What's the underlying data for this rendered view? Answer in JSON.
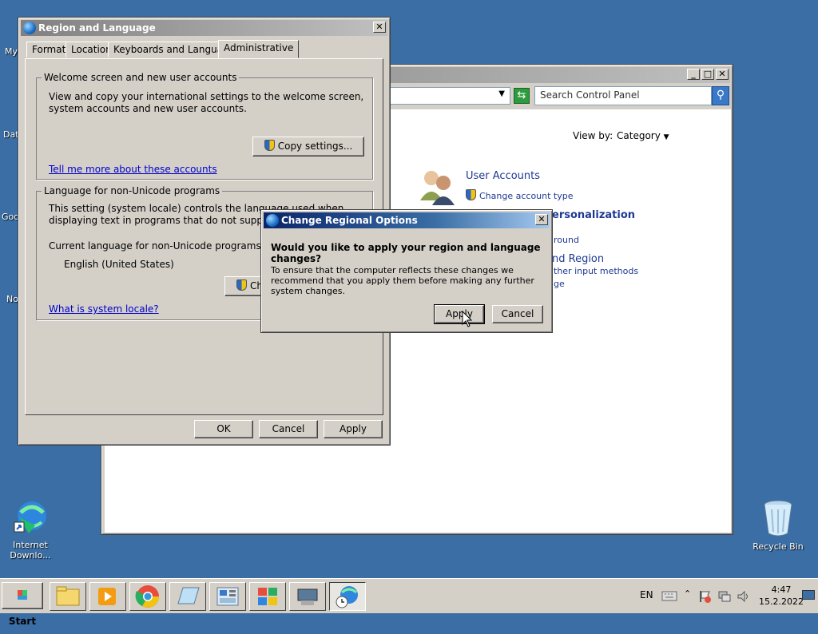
{
  "desktop": {
    "icons": [
      {
        "label": "Internet Downlo..."
      },
      {
        "label": "Recycle Bin"
      }
    ],
    "partial_labels": [
      "My",
      "Dat",
      "Goo",
      "No"
    ]
  },
  "region_dialog": {
    "title": "Region and Language",
    "tabs": [
      "Formats",
      "Location",
      "Keyboards and Languages",
      "Administrative"
    ],
    "welcome_group": {
      "title": "Welcome screen and new user accounts",
      "description": "View and copy your international settings to the welcome screen, system accounts and new user accounts.",
      "copy_button": "Copy settings...",
      "link": "Tell me more about these accounts"
    },
    "unicode_group": {
      "title": "Language for non-Unicode programs",
      "description": "This setting (system locale) controls the language used when displaying text in programs that do not support Unicode.",
      "current_label": "Current language for non-Unicode programs:",
      "current_value": "English (United States)",
      "change_button_partial": "Ch",
      "link": "What is system locale?"
    },
    "buttons": {
      "ok": "OK",
      "cancel": "Cancel",
      "apply": "Apply"
    }
  },
  "control_panel": {
    "search_placeholder": "Search Control Panel",
    "view_by_label": "View by:",
    "view_by_value": "Category",
    "user_accounts": {
      "title": "User Accounts",
      "sub": "Change account type"
    },
    "personalization_partial": "ersonalization",
    "personalization_sub_partial": "round",
    "region_partial": "nd Region",
    "region_sub1_partial": "ther input methods",
    "region_sub2_partial": "ge"
  },
  "change_options_dialog": {
    "title": "Change Regional Options",
    "question": "Would you like to apply your region and language changes?",
    "body": "To ensure that the computer reflects these changes we recommend that you apply them before making any further system changes.",
    "apply": "Apply",
    "cancel": "Cancel"
  },
  "taskbar": {
    "start": "Start",
    "language": "EN",
    "time": "4:47",
    "date": "15.2.2022"
  }
}
